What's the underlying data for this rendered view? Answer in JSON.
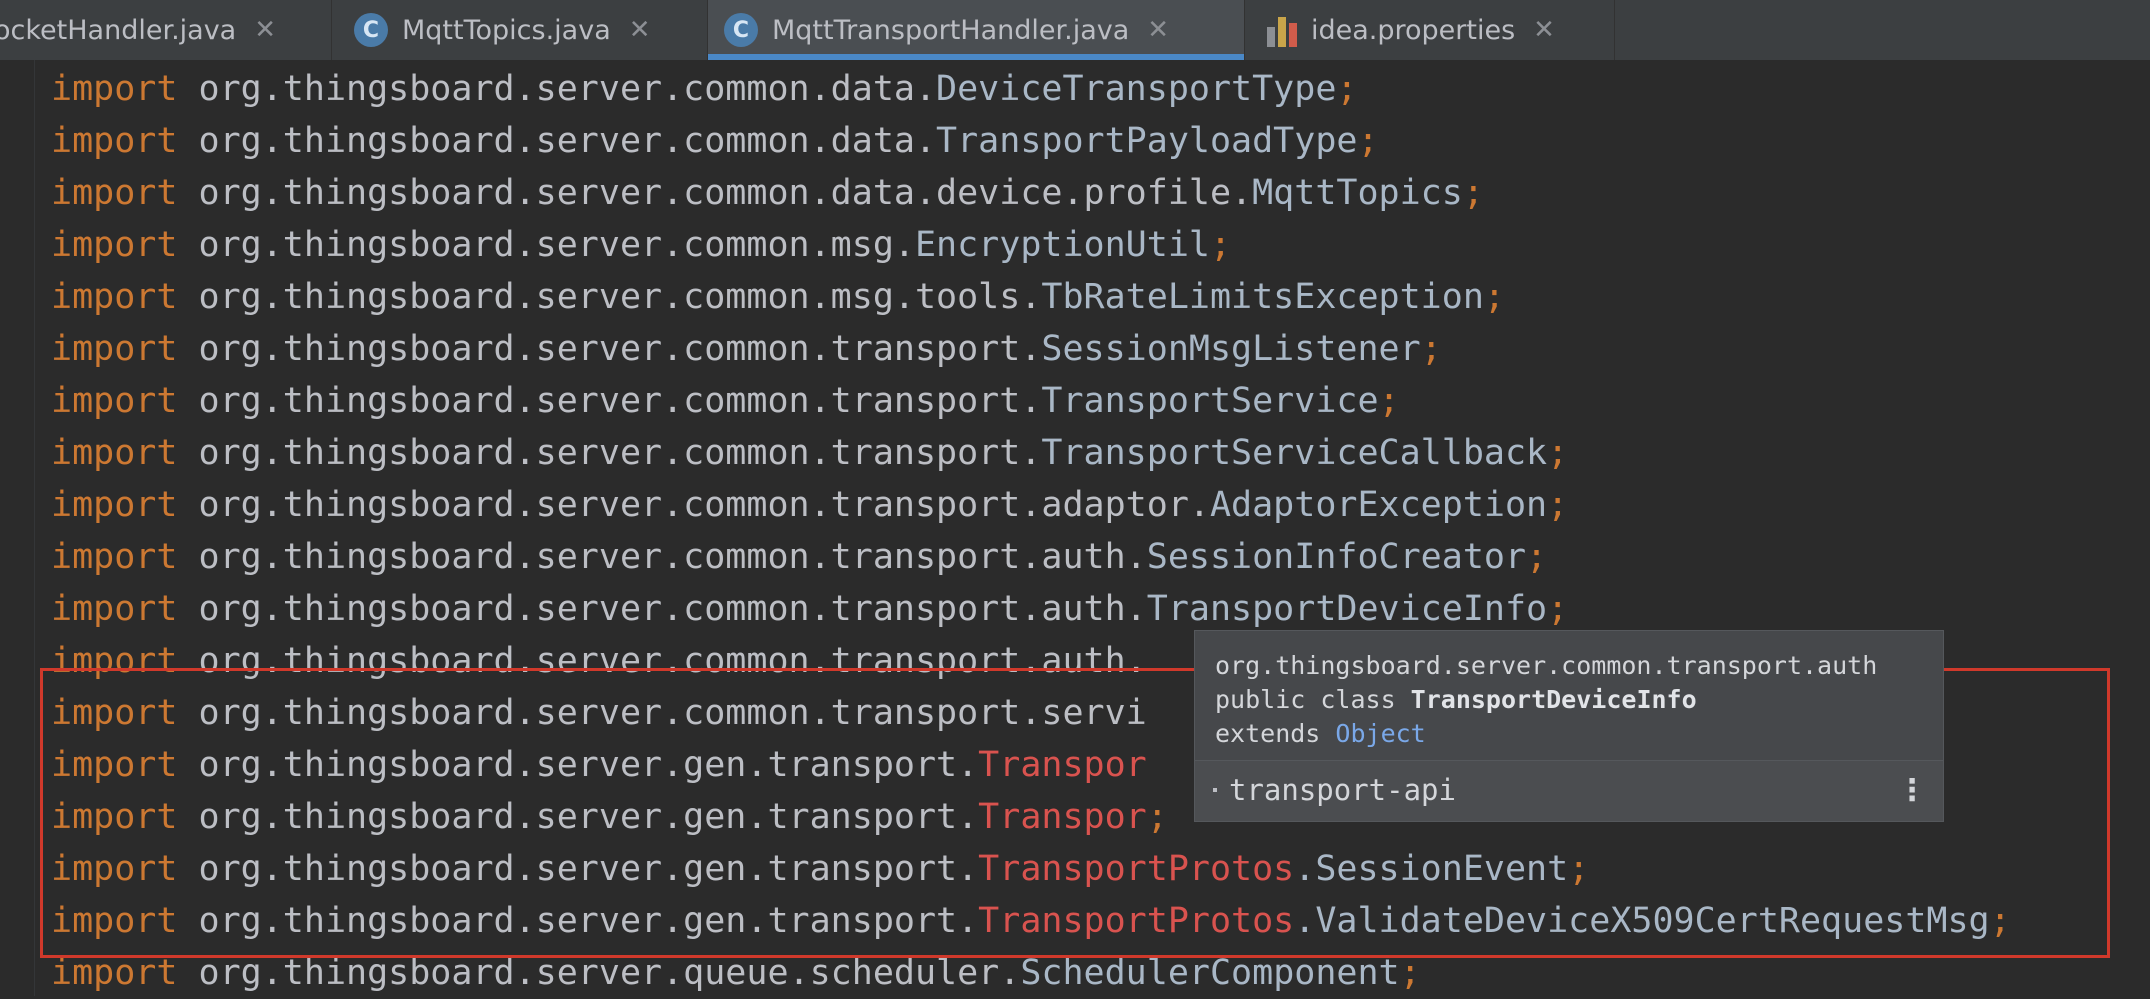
{
  "tabs": [
    {
      "name": "ocketHandler.java",
      "icon": "none",
      "active": false
    },
    {
      "name": "MqttTopics.java",
      "icon": "java-class-icon",
      "active": false
    },
    {
      "name": "MqttTransportHandler.java",
      "icon": "java-class-icon",
      "active": true
    },
    {
      "name": "idea.properties",
      "icon": "properties-file-icon",
      "active": false
    }
  ],
  "tab_icon_letter": "C",
  "tab_close_glyph": "✕",
  "code": {
    "keyword": "import",
    "lines": [
      {
        "pkg": "org.thingsboard.server.common.data.",
        "proto": "",
        "rest": "DeviceTransportType",
        "semi": ";"
      },
      {
        "pkg": "org.thingsboard.server.common.data.",
        "proto": "",
        "rest": "TransportPayloadType",
        "semi": ";"
      },
      {
        "pkg": "org.thingsboard.server.common.data.device.profile.",
        "proto": "",
        "rest": "MqttTopics",
        "semi": ";"
      },
      {
        "pkg": "org.thingsboard.server.common.msg.",
        "proto": "",
        "rest": "EncryptionUtil",
        "semi": ";"
      },
      {
        "pkg": "org.thingsboard.server.common.msg.tools.",
        "proto": "",
        "rest": "TbRateLimitsException",
        "semi": ";"
      },
      {
        "pkg": "org.thingsboard.server.common.transport.",
        "proto": "",
        "rest": "SessionMsgListener",
        "semi": ";"
      },
      {
        "pkg": "org.thingsboard.server.common.transport.",
        "proto": "",
        "rest": "TransportService",
        "semi": ";"
      },
      {
        "pkg": "org.thingsboard.server.common.transport.",
        "proto": "",
        "rest": "TransportServiceCallback",
        "semi": ";"
      },
      {
        "pkg": "org.thingsboard.server.common.transport.adaptor.",
        "proto": "",
        "rest": "AdaptorException",
        "semi": ";"
      },
      {
        "pkg": "org.thingsboard.server.common.transport.auth.",
        "proto": "",
        "rest": "SessionInfoCreator",
        "semi": ";"
      },
      {
        "pkg": "org.thingsboard.server.common.transport.auth.",
        "proto": "",
        "rest": "TransportDeviceInfo",
        "semi": ";"
      },
      {
        "pkg": "org.thingsboard.server.common.transport.auth.",
        "proto": "",
        "rest": "",
        "semi": ""
      },
      {
        "pkg": "org.thingsboard.server.common.transport.servi",
        "proto": "",
        "rest": "",
        "semi": ""
      },
      {
        "pkg": "org.thingsboard.server.gen.transport.",
        "proto": "Transpor",
        "rest": "",
        "semi": ""
      },
      {
        "pkg": "org.thingsboard.server.gen.transport.",
        "proto": "Transpor",
        "rest": "",
        "semi": ";"
      },
      {
        "pkg": "org.thingsboard.server.gen.transport.",
        "proto": "TransportProtos",
        "rest": ".SessionEvent",
        "semi": ";"
      },
      {
        "pkg": "org.thingsboard.server.gen.transport.",
        "proto": "TransportProtos",
        "rest": ".ValidateDeviceX509CertRequestMsg",
        "semi": ";"
      },
      {
        "pkg": "org.thingsboard.server.queue.scheduler.",
        "proto": "",
        "rest": "SchedulerComponent",
        "semi": ";"
      }
    ]
  },
  "popup": {
    "package": "org.thingsboard.server.common.transport.auth",
    "decl_prefix": "public class ",
    "class_name": "TransportDeviceInfo",
    "extends_kw": "extends ",
    "extends_class": "Object",
    "library": "transport-api",
    "more_glyph": "⋮"
  },
  "colors": {
    "background": "#2b2b2b",
    "keyword": "#cc7832",
    "highlight_box": "#d0392b",
    "active_tab_underline": "#4a88c7",
    "proto_class": "#d9534f"
  }
}
